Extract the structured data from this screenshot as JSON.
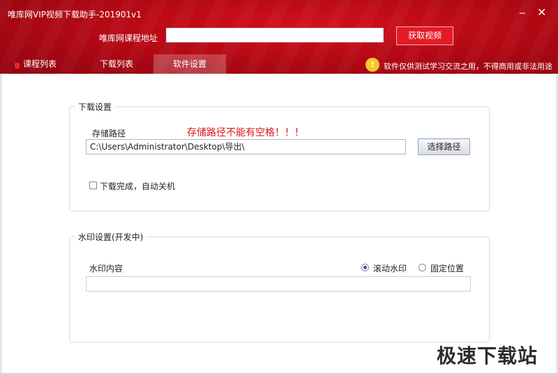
{
  "window": {
    "title": "唯库网VIP视频下载助手-201901v1",
    "minimize_glyph": "_",
    "close_glyph": "✕"
  },
  "header": {
    "url_label": "唯库网课程地址",
    "url_value": "",
    "fetch_button": "获取视频",
    "notice_icon": "!",
    "notice": "软件仅供测试学习交流之用，不得商用或非法用途"
  },
  "tabs": [
    {
      "label": "课程列表",
      "active": false
    },
    {
      "label": "下载列表",
      "active": false
    },
    {
      "label": "软件设置",
      "active": true
    }
  ],
  "download_settings": {
    "group_title": "下载设置",
    "path_label": "存储路径",
    "warning": "存储路径不能有空格！！！",
    "path_value": "C:\\Users\\Administrator\\Desktop\\导出\\",
    "choose_button": "选择路径",
    "shutdown_label": "下载完成，自动关机",
    "shutdown_checked": false
  },
  "watermark_settings": {
    "group_title": "水印设置(开发中)",
    "content_label": "水印内容",
    "mode_options": [
      "滚动水印",
      "固定位置"
    ],
    "selected_mode": "滚动水印",
    "content_value": ""
  },
  "site_watermark": "极速下载站",
  "colors": {
    "header_red": "#b00814",
    "button_red": "#e51a24",
    "warning_red": "#d9141e",
    "notice_yellow": "#f7c72c"
  }
}
